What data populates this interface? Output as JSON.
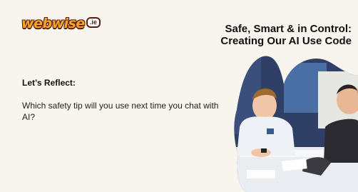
{
  "logo": {
    "word": "webwise",
    "badge": ".ie"
  },
  "title": {
    "line1": "Safe, Smart & in Control:",
    "line2": "Creating Our AI Use Code"
  },
  "reflect": {
    "heading": "Let’s Reflect:"
  },
  "question": {
    "text": "Which safety tip will you use next time you chat with AI?"
  },
  "colors": {
    "background": "#f8f5ee",
    "logo_orange": "#f5a623",
    "logo_outline": "#5a1d12",
    "text": "#111111"
  }
}
